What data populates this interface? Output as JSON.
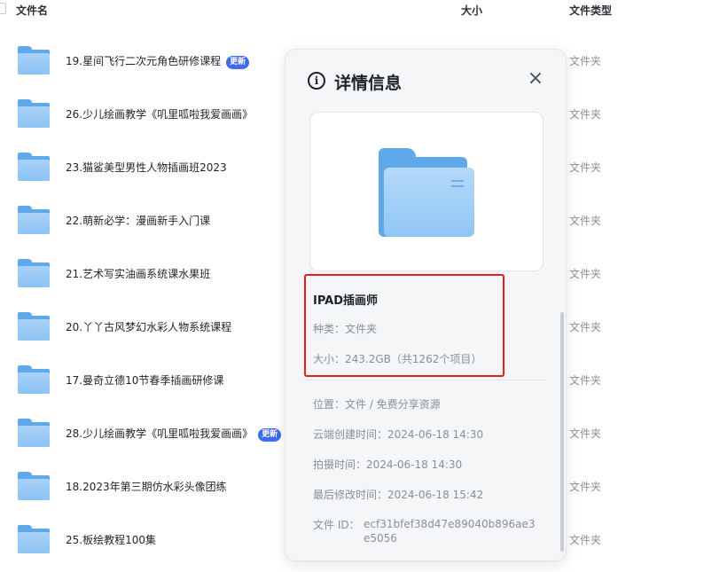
{
  "header": {
    "name_col": "文件名",
    "size_col": "大小",
    "type_col": "文件类型"
  },
  "files": [
    {
      "name": "19.星间飞行二次元角色研修课程",
      "badge": "更新",
      "type": "文件夹"
    },
    {
      "name": "26.少儿绘画教学《叽里呱啦我爱画画》",
      "badge": "",
      "type": "文件夹"
    },
    {
      "name": "23.猫鲨美型男性人物插画班2023",
      "badge": "",
      "type": "文件夹"
    },
    {
      "name": "22.萌新必学：漫画新手入门课",
      "badge": "",
      "type": "文件夹"
    },
    {
      "name": "21.艺术写实油画系统课水果班",
      "badge": "",
      "type": "文件夹"
    },
    {
      "name": "20.丫丫古风梦幻水彩人物系统课程",
      "badge": "",
      "type": "文件夹"
    },
    {
      "name": "17.曼奇立德10节春季插画研修课",
      "badge": "",
      "type": "文件夹"
    },
    {
      "name": "28.少儿绘画教学《叽里呱啦我爱画画》",
      "badge": "更新",
      "type": "文件夹"
    },
    {
      "name": "18.2023年第三期仿水彩头像团练",
      "badge": "",
      "type": "文件夹"
    },
    {
      "name": "25.板绘教程100集",
      "badge": "",
      "type": "文件夹"
    }
  ],
  "panel": {
    "title": "详情信息",
    "info_icon": "info-icon",
    "close_icon": "close-icon",
    "item_name": "IPAD插画师",
    "kind": "种类：文件夹",
    "size": "大小：243.2GB（共1262个项目）",
    "location": "位置：文件 / 免费分享资源",
    "created": "云端创建时间：2024-06-18 14:30",
    "shot": "拍摄时间：2024-06-18 14:30",
    "modified": "最后修改时间：2024-06-18 15:42",
    "file_id_label": "文件 ID：",
    "file_id_value": "ecf31bfef38d47e89040b896ae3e5056"
  },
  "colors": {
    "accent": "#3f6bf0",
    "folder": "#5fa8ea",
    "highlight": "#e02020"
  }
}
